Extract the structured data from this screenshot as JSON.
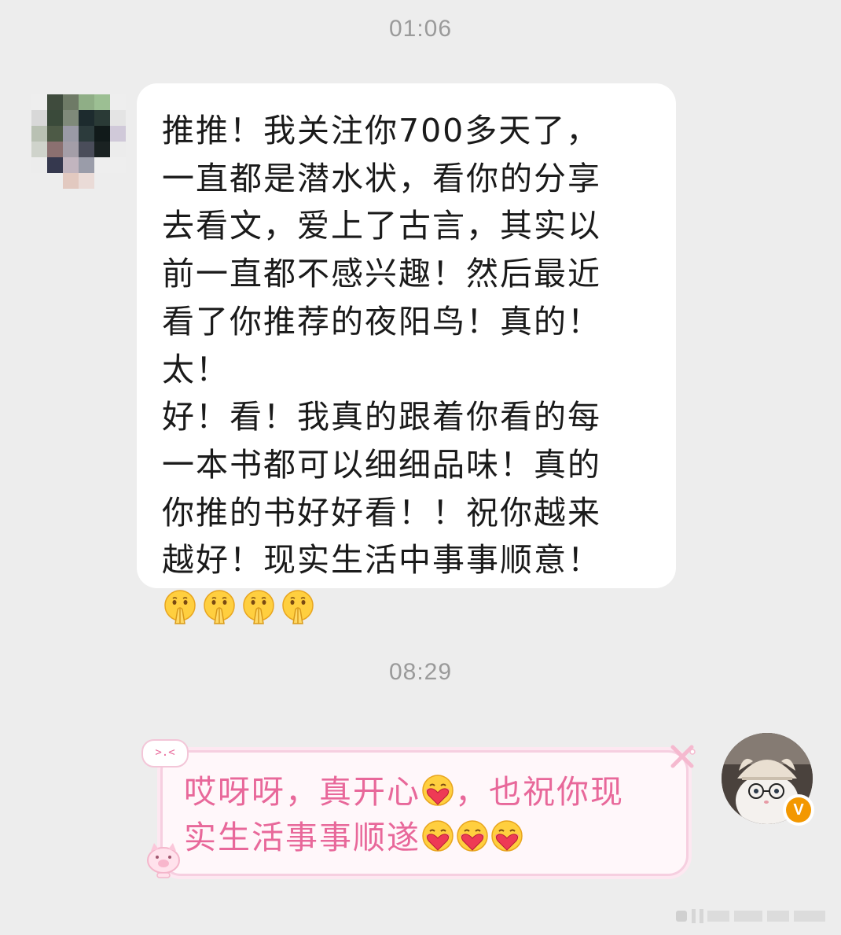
{
  "chat": {
    "timestamp_1": "01:06",
    "timestamp_2": "08:29",
    "incoming_message": "推推！我关注你700多天了，\n一直都是潜水状，看你的分享\n去看文，爱上了古言，其实以\n前一直都不感兴趣！然后最近\n看了你推荐的夜阳鸟！真的！太！\n好！看！我真的跟着你看的每\n一本书都可以细细品味！真的\n你推的书好好看！！祝你越来\n越好！现实生活中事事顺意！",
    "incoming_emojis": [
      "pray-emoji",
      "pray-emoji",
      "pray-emoji",
      "pray-emoji"
    ],
    "outgoing_part1": "哎呀呀，真开心",
    "outgoing_part2": "，也祝你现",
    "outgoing_part3": "实生活事事顺遂",
    "outgoing_emojis": [
      "heart-hug-emoji",
      "heart-hug-emoji",
      "heart-hug-emoji",
      "heart-hug-emoji"
    ],
    "bubble_decoration_text": ">.<"
  },
  "colors": {
    "background": "#ededed",
    "incoming_bubble": "#ffffff",
    "outgoing_text": "#e8689a",
    "outgoing_border": "#f6cfe0",
    "timestamp": "#9a9a9a",
    "verified_badge": "#f39800"
  },
  "icons": {
    "verified": "V"
  }
}
